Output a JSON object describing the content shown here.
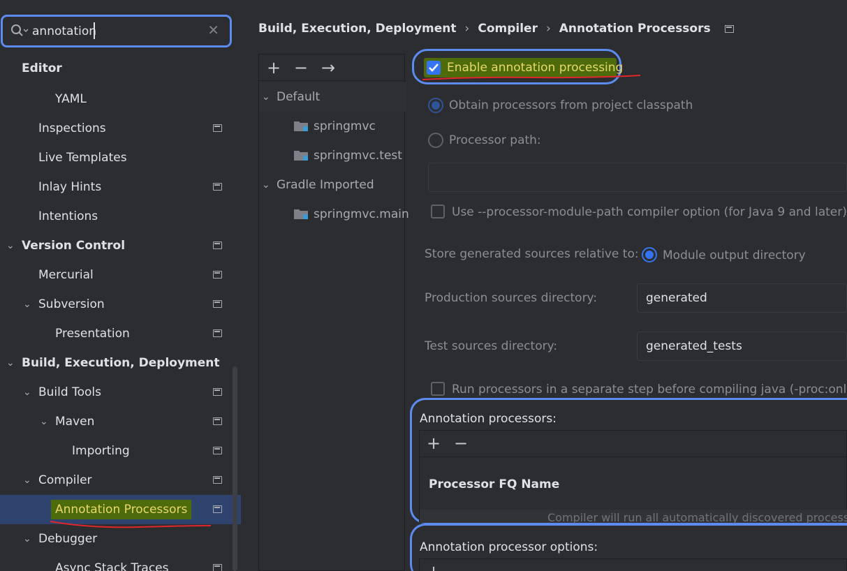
{
  "search": {
    "value": "annotation"
  },
  "sidebar": {
    "items": [
      {
        "label": "Editor"
      },
      {
        "label": "YAML"
      },
      {
        "label": "Inspections"
      },
      {
        "label": "Live Templates"
      },
      {
        "label": "Inlay Hints"
      },
      {
        "label": "Intentions"
      },
      {
        "label": "Version Control"
      },
      {
        "label": "Mercurial"
      },
      {
        "label": "Subversion"
      },
      {
        "label": "Presentation"
      },
      {
        "label": "Build, Execution, Deployment"
      },
      {
        "label": "Build Tools"
      },
      {
        "label": "Maven"
      },
      {
        "label": "Importing"
      },
      {
        "label": "Compiler"
      },
      {
        "label": "Annotation Processors"
      },
      {
        "label": "Debugger"
      },
      {
        "label": "Async Stack Traces"
      }
    ]
  },
  "breadcrumb": {
    "items": [
      "Build, Execution, Deployment",
      "Compiler",
      "Annotation Processors"
    ]
  },
  "profiles": {
    "toolbar": {
      "add": "+",
      "remove": "−",
      "move": "→"
    },
    "items": [
      {
        "label": "Default"
      },
      {
        "label": "springmvc"
      },
      {
        "label": "springmvc.test"
      },
      {
        "label": "Gradle Imported"
      },
      {
        "label": "springmvc.main"
      }
    ]
  },
  "settings": {
    "enable_annotation_processing": {
      "label": "Enable annotation processing",
      "checked": true
    },
    "obtain_from_classpath": {
      "label": "Obtain processors from project classpath",
      "selected": true
    },
    "processor_path": {
      "label": "Processor path:",
      "selected": false,
      "value": ""
    },
    "module_path_option": {
      "label": "Use --processor-module-path compiler option (for Java 9 and later)",
      "checked": false
    },
    "store_generated_label": "Store generated sources relative to:",
    "module_output_directory": {
      "label": "Module output directory",
      "selected": true
    },
    "production_sources": {
      "label": "Production sources directory:",
      "value": "generated"
    },
    "test_sources": {
      "label": "Test sources directory:",
      "value": "generated_tests"
    },
    "run_separate_step": {
      "label": "Run processors in a separate step before compiling java (-proc:only m",
      "checked": false
    },
    "annotation_processors": {
      "label": "Annotation processors:",
      "add": "+",
      "remove": "−",
      "column_header": "Processor FQ Name",
      "empty_text": "Compiler will run all automatically discovered processo"
    },
    "annotation_processor_options": {
      "label": "Annotation processor options:",
      "add": "+"
    }
  },
  "colors": {
    "accent": "#3574f0",
    "highlight_ring": "#5d8bf0",
    "marker_green": "#4d6b0a",
    "marker_text": "#e8d86a",
    "red_underline": "#e0272b"
  }
}
